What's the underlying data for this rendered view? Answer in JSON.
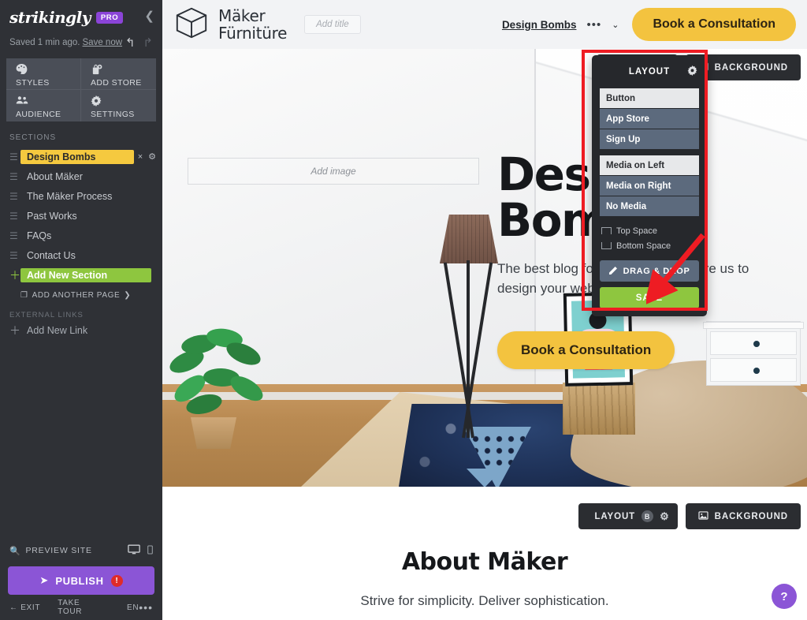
{
  "sidebar": {
    "brand": "strikingly",
    "plan_badge": "PRO",
    "collapse_icon": "chevron-left-icon",
    "save_status": "Saved 1 min ago.",
    "save_now": "Save now",
    "undo_icon": "undo-arrow-icon",
    "redo_icon": "redo-arrow-icon",
    "tiles": [
      {
        "label": "STYLES",
        "icon": "palette-icon",
        "glyph": "◕"
      },
      {
        "label": "ADD STORE",
        "icon": "store-bag-plus-icon",
        "glyph": "🛍"
      },
      {
        "label": "AUDIENCE",
        "icon": "people-icon",
        "glyph": "👥"
      },
      {
        "label": "SETTINGS",
        "icon": "gear-icon",
        "glyph": "⚙"
      }
    ],
    "sections_header": "SECTIONS",
    "sections": [
      {
        "label": "Design Bombs",
        "active": true
      },
      {
        "label": "About Mäker",
        "active": false
      },
      {
        "label": "The Mäker Process",
        "active": false
      },
      {
        "label": "Past Works",
        "active": false
      },
      {
        "label": "FAQs",
        "active": false
      },
      {
        "label": "Contact Us",
        "active": false
      }
    ],
    "active_section_actions": {
      "remove": "×",
      "settings": "⚙"
    },
    "add_new_section": "Add New Section",
    "add_another_page": "ADD ANOTHER PAGE",
    "add_another_page_caret": "❯",
    "external_links_header": "EXTERNAL LINKS",
    "add_new_link": "Add New Link",
    "preview_site": "PREVIEW SITE",
    "preview_icons": {
      "desktop": "desktop-icon",
      "mobile": "mobile-icon"
    },
    "publish_label": "PUBLISH",
    "publish_alert": "!",
    "footer": {
      "exit": "EXIT",
      "take_tour": "TAKE TOUR",
      "language": "EN",
      "more": "•••"
    }
  },
  "topnav": {
    "logo_icon": "cube-logo-icon",
    "brand_line1": "Mäker",
    "brand_line2": "Fürnitüre",
    "title_placeholder": "Add title",
    "nav_link": "Design Bombs",
    "nav_more": "•••",
    "nav_caret": "⌄",
    "cta": "Book a Consultation"
  },
  "hero": {
    "add_image_placeholder": "Add image",
    "headline": "Design Bombs",
    "body": "The best blog for your business. Hire us to design your website today.",
    "cta": "Book a Consultation"
  },
  "editor_chips": {
    "top": {
      "layout_label": "LAYOUT",
      "layout_gear": "⚙",
      "background_label": "BACKGROUND",
      "background_icon": "image-icon"
    },
    "bottom": {
      "layout_label": "LAYOUT",
      "layout_badge": "B",
      "layout_gear": "⚙",
      "background_label": "BACKGROUND",
      "background_icon": "image-icon"
    }
  },
  "layout_popup": {
    "title": "LAYOUT",
    "gear_icon": "gear-icon",
    "button_options": [
      {
        "label": "Button",
        "selected": true
      },
      {
        "label": "App Store",
        "selected": false
      },
      {
        "label": "Sign Up",
        "selected": false
      }
    ],
    "media_options": [
      {
        "label": "Media on Left",
        "selected": true
      },
      {
        "label": "Media on Right",
        "selected": false
      },
      {
        "label": "No Media",
        "selected": false
      }
    ],
    "spacing": [
      {
        "label": "Top Space",
        "icon": "top-space-icon"
      },
      {
        "label": "Bottom Space",
        "icon": "bottom-space-icon"
      }
    ],
    "drag_drop": "DRAG & DROP",
    "drag_drop_icon": "pencil-icon",
    "save": "SAVE"
  },
  "annotation": {
    "highlight_color": "#ee1c23",
    "arrow_icon": "red-arrow-icon",
    "arrow_target": "drag-and-drop-button"
  },
  "about": {
    "heading": "About Mäker",
    "subheading": "Strive for simplicity. Deliver sophistication."
  },
  "help": {
    "label": "?",
    "icon": "question-mark-icon"
  },
  "colors": {
    "sidebar_bg": "#2f3136",
    "accent_yellow": "#f3c33f",
    "accent_green": "#8ec63f",
    "accent_purple": "#8b55d6",
    "highlight_red": "#ee1c23",
    "option_blue": "#5c6a7d"
  }
}
